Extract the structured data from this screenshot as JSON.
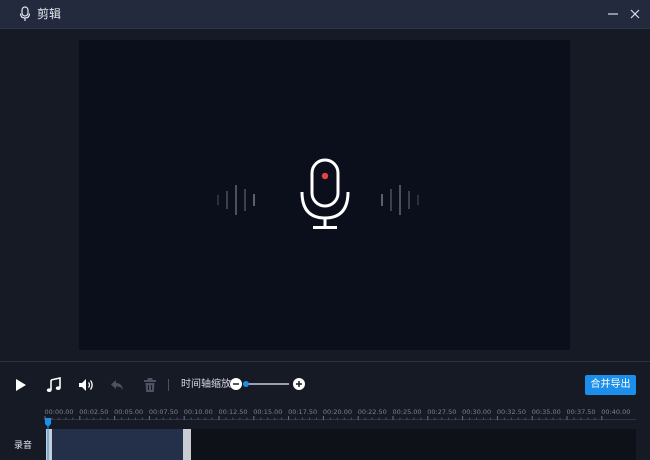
{
  "window": {
    "title": "剪辑",
    "title_icon": "mic-icon",
    "minimize_icon": "minimize-icon",
    "close_icon": "close-icon"
  },
  "preview": {
    "background": "#0b0f1b",
    "icon": "microphone-icon",
    "record_dot_color": "#e0454a"
  },
  "toolbar": {
    "play_icon": "play-icon",
    "music_icon": "music-note-icon",
    "volume_icon": "volume-icon",
    "undo_icon": "undo-icon",
    "delete_icon": "trash-icon",
    "zoom_label": "时间轴缩放",
    "zoom_level": 0.0,
    "export_label": "合并导出",
    "accent_color": "#1c8fea"
  },
  "timeline": {
    "ticks": [
      "00:00.00",
      "00:02.50",
      "00:05.00",
      "00:07.50",
      "00:10.00",
      "00:12.50",
      "00:15.00",
      "00:17.50",
      "00:20.00",
      "00:22.50",
      "00:25.00",
      "00:27.50",
      "00:30.00",
      "00:32.50",
      "00:35.00",
      "00:37.50",
      "00:40.00"
    ],
    "track_label": "录音",
    "playhead_time": "00:00.00"
  }
}
